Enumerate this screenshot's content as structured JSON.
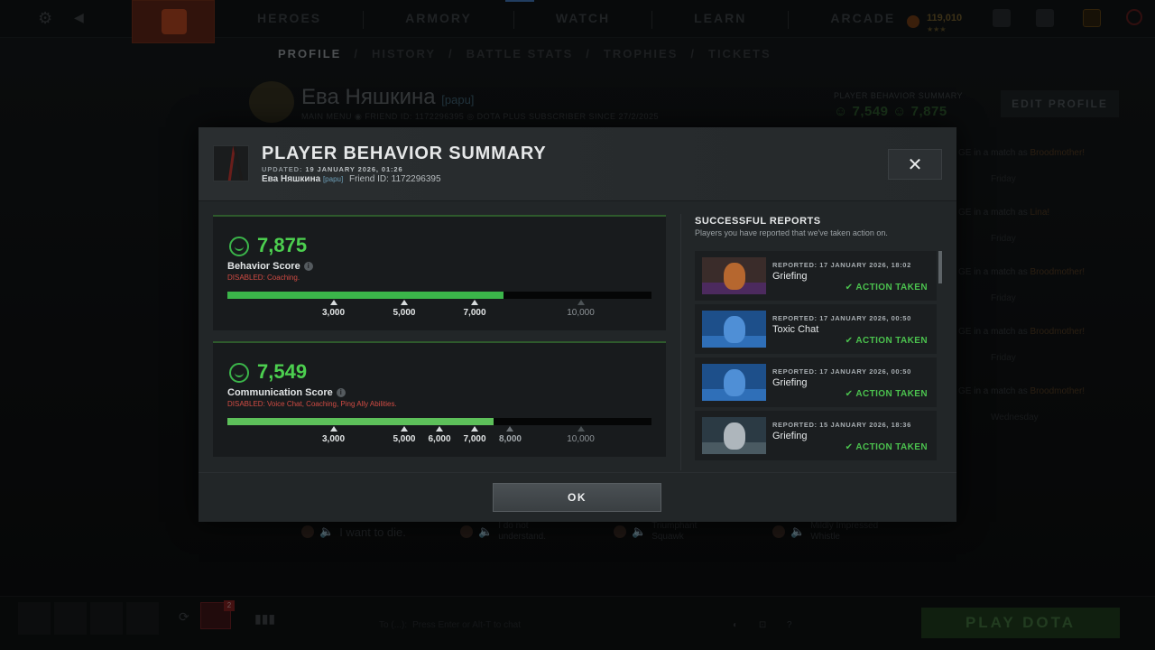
{
  "topbar": {
    "nav": [
      "HEROES",
      "ARMORY",
      "WATCH",
      "LEARN",
      "ARCADE"
    ],
    "currency": "119,010",
    "currency_stars": "★★★"
  },
  "subnav": {
    "profile": "PROFILE",
    "history": "HISTORY",
    "battle_stats": "BATTLE STATS",
    "trophies": "TROPHIES",
    "tickets": "TICKETS",
    "sep": "/"
  },
  "profile": {
    "name": "Ева Няшкина",
    "tag": "[papu]",
    "meta": "MAIN MENU   ◉ FRIEND ID: 1172296395   ◎ DOTA PLUS SUBSCRIBER   SINCE 27/2/2025",
    "pbs_label": "PLAYER BEHAVIOR SUMMARY",
    "pbs_nums": "☺ 7,549  ☺ 7,875",
    "edit_profile": "EDIT PROFILE"
  },
  "background_feed": [
    {
      "text": "GE in a match as ",
      "hero": "Broodmother!",
      "sub": "Friday"
    },
    {
      "text": "GE in a match as ",
      "hero": "Lina!",
      "sub": "Friday"
    },
    {
      "text": "GE in a match as ",
      "hero": "Broodmother!",
      "sub": "Friday"
    },
    {
      "text": "GE in a match as ",
      "hero": "Broodmother!",
      "sub": "Friday"
    },
    {
      "text": "GE in a match as ",
      "hero": "Broodmother!",
      "sub": "Wednesday"
    }
  ],
  "chatwheel": {
    "item1": "I want to die.",
    "item2": "I do not understand.",
    "item3": "Triumphant Squawk",
    "item4": "Mildly Impressed Whistle"
  },
  "bottombar": {
    "badge": "2",
    "chat_prefix": "To (...):",
    "chat_placeholder": "Press Enter or Alt-T to chat",
    "icons": "◐ ⊡ ?",
    "play": "PLAY DOTA"
  },
  "modal": {
    "title": "PLAYER BEHAVIOR SUMMARY",
    "updated_label": "UPDATED:",
    "updated_value": "19 JANUARY 2026, 01:26",
    "user_name": "Ева Няшкина",
    "user_tag": "[papu]",
    "friend_id": "Friend ID: 1172296395",
    "close": "✕",
    "ok": "OK",
    "behavior": {
      "value": "7,875",
      "label": "Behavior Score",
      "disabled_label": "DISABLED:",
      "disabled_items": "Coaching.",
      "progress": 0.65,
      "ticks": [
        {
          "label": "3,000",
          "pos": 0.25,
          "state": "reached"
        },
        {
          "label": "5,000",
          "pos": 0.417,
          "state": "reached"
        },
        {
          "label": "7,000",
          "pos": 0.583,
          "state": "reached"
        },
        {
          "label": "10,000",
          "pos": 0.833,
          "state": "locked"
        }
      ]
    },
    "communication": {
      "value": "7,549",
      "label": "Communication Score",
      "disabled_label": "DISABLED:",
      "disabled_items": "Voice Chat, Coaching, Ping Ally Abilities.",
      "progress": 0.627,
      "ticks": [
        {
          "label": "3,000",
          "pos": 0.25,
          "state": "reached"
        },
        {
          "label": "5,000",
          "pos": 0.417,
          "state": "reached"
        },
        {
          "label": "6,000",
          "pos": 0.5,
          "state": "reached"
        },
        {
          "label": "7,000",
          "pos": 0.583,
          "state": "reached"
        },
        {
          "label": "8,000",
          "pos": 0.667,
          "state": "next"
        },
        {
          "label": "10,000",
          "pos": 0.833,
          "state": "locked"
        }
      ]
    },
    "reports_title": "SUCCESSFUL REPORTS",
    "reports_subtitle": "Players you have reported that we've taken action on.",
    "reports": [
      {
        "date": "REPORTED: 17 JANUARY 2026, 18:02",
        "reason": "Griefing",
        "status": "ACTION TAKEN",
        "hero": "anti-mage-portrait",
        "c1": "#b6672f",
        "c2": "#4c2a5e",
        "bg": "#3a2c2a"
      },
      {
        "date": "REPORTED: 17 JANUARY 2026, 00:50",
        "reason": "Toxic Chat",
        "status": "ACTION TAKEN",
        "hero": "razor-portrait",
        "c1": "#4f8fd6",
        "c2": "#2f6fb8",
        "bg": "#1d4f8a"
      },
      {
        "date": "REPORTED: 17 JANUARY 2026, 00:50",
        "reason": "Griefing",
        "status": "ACTION TAKEN",
        "hero": "razor-portrait",
        "c1": "#4f8fd6",
        "c2": "#2f6fb8",
        "bg": "#1d4f8a"
      },
      {
        "date": "REPORTED: 15 JANUARY 2026, 18:36",
        "reason": "Griefing",
        "status": "ACTION TAKEN",
        "hero": "sven-portrait",
        "c1": "#aeb6bc",
        "c2": "#4a5a62",
        "bg": "#2b3a44"
      }
    ]
  }
}
